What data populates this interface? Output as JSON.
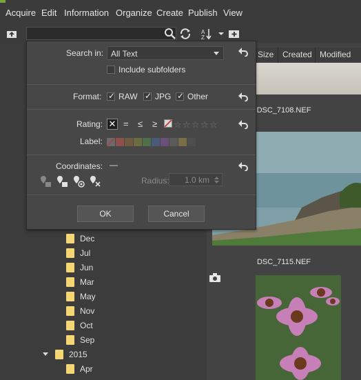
{
  "menu": [
    "Acquire",
    "Edit",
    "Information",
    "Organize",
    "Create",
    "Publish",
    "View"
  ],
  "toolbar": {
    "search_value": ""
  },
  "columns": [
    "Size",
    "Created",
    "Modified"
  ],
  "search": {
    "search_in_label": "Search in:",
    "search_in_value": "All Text",
    "include_subfolders": "Include subfolders",
    "format_label": "Format:",
    "formats": [
      "RAW",
      "JPG",
      "Other"
    ],
    "rating_label": "Rating:",
    "rating_ops": [
      "=",
      "≤",
      "≥"
    ],
    "label_label": "Label:",
    "coordinates_label": "Coordinates:",
    "coordinates_value": "—",
    "radius_label": "Radius:",
    "radius_value": "1.0 km",
    "ok": "OK",
    "cancel": "Cancel"
  },
  "label_colors": [
    "#8f4f4f",
    "#6f5a3f",
    "#6b6b40",
    "#4f6f4a",
    "#4a5a7a",
    "#6a4f7a",
    "#5a5a5a",
    "#7a6e4a",
    "#4e4e4e"
  ],
  "tree": {
    "months": [
      "Dec",
      "Jul",
      "Jun",
      "Mar",
      "May",
      "Nov",
      "Oct",
      "Sep"
    ],
    "year": "2015",
    "year_months": [
      "Apr"
    ]
  },
  "thumbnails": [
    "DSC_7108.NEF",
    "DSC_7115.NEF"
  ]
}
